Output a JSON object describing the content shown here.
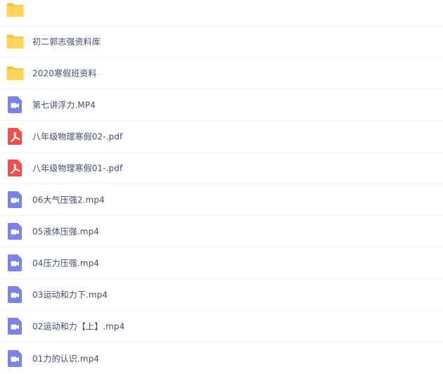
{
  "files": [
    {
      "name": "",
      "type": "folder",
      "icon": "folder-icon"
    },
    {
      "name": "初二郭志强资料库",
      "type": "folder",
      "icon": "folder-icon"
    },
    {
      "name": "2020寒假班资料",
      "type": "folder",
      "icon": "folder-icon"
    },
    {
      "name": "第七讲浮力.MP4",
      "type": "video",
      "icon": "video-file-icon"
    },
    {
      "name": "八年级物理寒假02-.pdf",
      "type": "pdf",
      "icon": "pdf-file-icon"
    },
    {
      "name": "八年级物理寒假01-.pdf",
      "type": "pdf",
      "icon": "pdf-file-icon"
    },
    {
      "name": "06大气压强2.mp4",
      "type": "video",
      "icon": "video-file-icon"
    },
    {
      "name": "05液体压强.mp4",
      "type": "video",
      "icon": "video-file-icon"
    },
    {
      "name": "04压力压强.mp4",
      "type": "video",
      "icon": "video-file-icon"
    },
    {
      "name": "03运动和力下.mp4",
      "type": "video",
      "icon": "video-file-icon"
    },
    {
      "name": "02运动和力【上】.mp4",
      "type": "video",
      "icon": "video-file-icon"
    },
    {
      "name": "01力的认识.mp4",
      "type": "video",
      "icon": "video-file-icon"
    }
  ],
  "colors": {
    "folder": "#ffd35c",
    "folder_tab": "#f5c33b",
    "video": "#7b83eb",
    "pdf": "#f24e4e",
    "text": "#424e67",
    "divider": "#f0f0f0"
  }
}
